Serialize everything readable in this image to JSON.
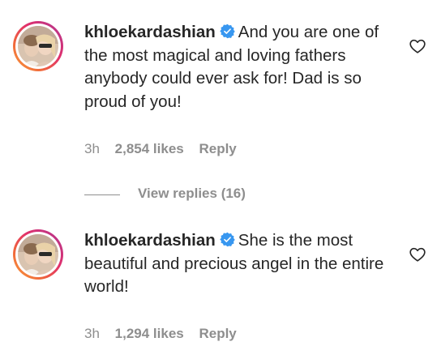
{
  "comments": [
    {
      "username": "khloekardashian",
      "text": "And you are one of the most magical and loving fathers anybody could ever ask for! Dad is so proud of you!",
      "time": "3h",
      "likes": "2,854 likes",
      "reply_label": "Reply"
    },
    {
      "username": "khloekardashian",
      "text": "She is the most beautiful and precious angel in the entire world!",
      "time": "3h",
      "likes": "1,294 likes",
      "reply_label": "Reply"
    }
  ],
  "view_replies": "View replies (16)",
  "colors": {
    "text": "#262626",
    "secondary": "#8e8e8e",
    "verified": "#3897f0"
  },
  "icons": {
    "verified": "verified-badge-icon",
    "like": "heart-outline-icon"
  }
}
